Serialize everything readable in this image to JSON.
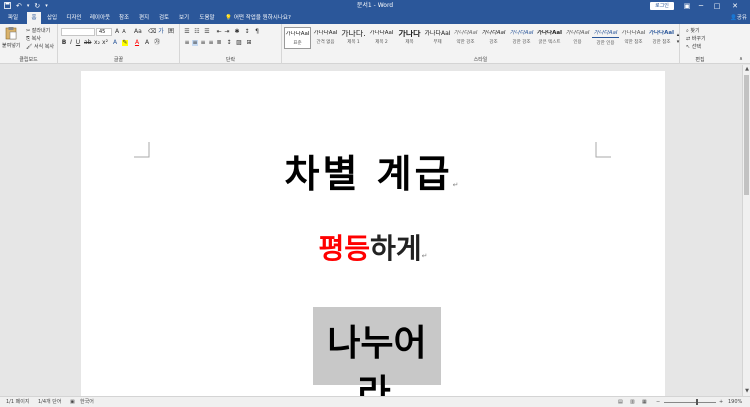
{
  "title_bar": {
    "doc_title": "문서1 - Word",
    "login_button": "로그인",
    "qa_icons": [
      "save-icon",
      "undo-icon",
      "redo-icon",
      "customize-icon"
    ],
    "window_controls": [
      "restore-ribbon-icon",
      "minimize-icon",
      "maximize-icon",
      "close-icon"
    ]
  },
  "tabs": [
    {
      "label": "파일",
      "active": false
    },
    {
      "label": "홈",
      "active": true
    },
    {
      "label": "삽입",
      "active": false
    },
    {
      "label": "디자인",
      "active": false
    },
    {
      "label": "레이아웃",
      "active": false
    },
    {
      "label": "참조",
      "active": false
    },
    {
      "label": "편지",
      "active": false
    },
    {
      "label": "검토",
      "active": false
    },
    {
      "label": "보기",
      "active": false
    },
    {
      "label": "도움말",
      "active": false
    }
  ],
  "tell_me": "어떤 작업을 원하시나요?",
  "share_label": "공유",
  "clipboard": {
    "paste_label": "붙여넣기",
    "cut_label": "잘라내기",
    "copy_label": "복사",
    "format_painter_label": "서식 복사",
    "group_label": "클립보드"
  },
  "font": {
    "font_name": "",
    "font_size": "45",
    "group_label": "글꼴"
  },
  "paragraph": {
    "group_label": "단락"
  },
  "styles": {
    "items": [
      {
        "preview": "가나다AaI",
        "name": "표준",
        "selected": true
      },
      {
        "preview": "가나다AaI",
        "name": "간격 없음",
        "selected": false
      },
      {
        "preview": "가나다.",
        "name": "제목 1",
        "selected": false
      },
      {
        "preview": "가나다AaI",
        "name": "제목 2",
        "selected": false
      },
      {
        "preview": "가나다",
        "name": "제목",
        "selected": false
      },
      {
        "preview": "가나다AaI",
        "name": "부제",
        "selected": false
      },
      {
        "preview": "가나다AaI",
        "name": "약한 강조",
        "selected": false
      },
      {
        "preview": "가나다AaI",
        "name": "강조",
        "selected": false
      },
      {
        "preview": "가나다AaI",
        "name": "강한 강조",
        "selected": false
      },
      {
        "preview": "가나다AaI",
        "name": "굵은 텍스트",
        "selected": false
      },
      {
        "preview": "가나다AaI",
        "name": "인용",
        "selected": false
      },
      {
        "preview": "가나다AaI",
        "name": "강한 인용",
        "selected": false
      },
      {
        "preview": "가나다AaI",
        "name": "약한 참조",
        "selected": false
      },
      {
        "preview": "가나다AaI",
        "name": "강한 참조",
        "selected": false
      }
    ],
    "group_label": "스타일"
  },
  "editing": {
    "find_label": "찾기",
    "replace_label": "바꾸기",
    "select_label": "선택",
    "group_label": "편집"
  },
  "document": {
    "line1": "차별 계급",
    "line2_red": "평등",
    "line2_rest": "하게",
    "line3": "나누어라",
    "line2_color": "#ff0000",
    "highlight_color": "#c8c8c8"
  },
  "status_bar": {
    "page": "1/1 페이지",
    "words": "1/4개 단어",
    "language": "한국어",
    "zoom": "190%"
  },
  "colors": {
    "accent": "#2b579a",
    "ribbon_bg": "#f3f3f3"
  }
}
